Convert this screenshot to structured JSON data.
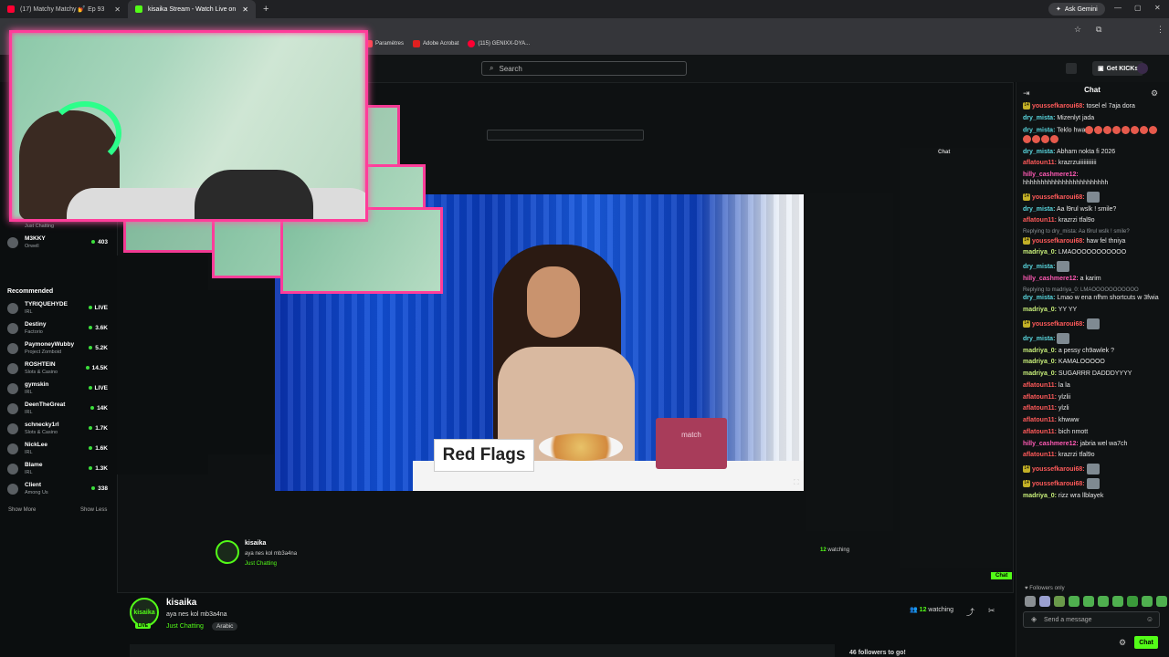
{
  "browser": {
    "tabs": [
      {
        "label": "(17) Matchy Matchy 💅 Ep 93 ",
        "color": "#ff0033"
      },
      {
        "label": "kisaika Stream - Watch Live on",
        "color": "#53fc18"
      }
    ],
    "ask_gemini": "Ask Gemini",
    "bookmarks": [
      "Paramètres",
      "Adobe Acrobat",
      "(115) GENIXX-DYA..."
    ]
  },
  "header": {
    "search_placeholder": "Search",
    "get_kicks": "Get KICKs"
  },
  "sidebar": {
    "top_items": [
      {
        "name": "M3KKY",
        "category": "Orwell",
        "count": "403"
      }
    ],
    "top_category": "Just Chatting",
    "recommended_title": "Recommended",
    "recommended": [
      {
        "name": "TYRIQUEHYDE",
        "category": "IRL",
        "count": "LIVE"
      },
      {
        "name": "Destiny",
        "category": "Factorio",
        "count": "3.6K"
      },
      {
        "name": "PaymoneyWubby",
        "category": "Project Zomboid",
        "count": "5.2K"
      },
      {
        "name": "ROSHTEIN",
        "category": "Slots & Casino",
        "count": "14.5K"
      },
      {
        "name": "gymskin",
        "category": "IRL",
        "count": "LIVE"
      },
      {
        "name": "DeenTheGreat",
        "category": "IRL",
        "count": "14K"
      },
      {
        "name": "schnecky1rl",
        "category": "Slots & Casino",
        "count": "1.7K"
      },
      {
        "name": "NickLee",
        "category": "IRL",
        "count": "1.6K"
      },
      {
        "name": "Blame",
        "category": "IRL",
        "count": "1.3K"
      },
      {
        "name": "Client",
        "category": "Among Us",
        "count": "338"
      }
    ],
    "show_more": "Show More",
    "show_less": "Show Less"
  },
  "video": {
    "red_flags": "Red Flags",
    "match_label": "match"
  },
  "stream": {
    "channel": "kisaika",
    "title": "aya nes kol mb3a4na",
    "category": "Just Chatting",
    "tag": "Arabic",
    "watching_count": "12",
    "watching_label": "watching",
    "live": "LIVE",
    "followers_goal": "46 followers to go!"
  },
  "chat": {
    "title": "Chat",
    "messages": [
      {
        "badge": "14",
        "user": "youssefkaroui68:",
        "color": "#ff5a5a",
        "text": " tosel el 7aja dora"
      },
      {
        "user": "dry_mista:",
        "color": "#5ad8e0",
        "text": " Mizenlyt jada"
      },
      {
        "user": "dry_mista:",
        "color": "#5ad8e0",
        "text": " Teklo hwa",
        "emotes": 12
      },
      {
        "user": "dry_mista:",
        "color": "#5ad8e0",
        "text": " Abham nokta fi 2026"
      },
      {
        "user": "aflatoun11:",
        "color": "#ff5a5a",
        "text": " krazrzuiiiiiiiiiiii"
      },
      {
        "user": "hilly_cashmere12:",
        "color": "#ff5ab4",
        "text": " hhhhhhhhhhhhhhhhhhhhhhhh"
      },
      {
        "badge": "14",
        "user": "youssefkaroui68:",
        "color": "#ff5a5a",
        "text": " ",
        "image": true
      },
      {
        "user": "dry_mista:",
        "color": "#5ad8e0",
        "text": " Aa l9rul wslk ! smile?"
      },
      {
        "user": "aflatoun11:",
        "color": "#ff5a5a",
        "text": " krazrzi tfal9o"
      },
      {
        "reply": "Replying to dry_mista: Aa l9rul wslk ! smile?",
        "badge": "14",
        "user": "youssefkaroui68:",
        "color": "#ff5a5a",
        "text": " haw fel thniya"
      },
      {
        "user": "madriya_0:",
        "color": "#c9f07a",
        "text": " LMAOOOOOOOOOOO"
      },
      {
        "user": "dry_mista:",
        "color": "#5ad8e0",
        "text": " ",
        "image": true
      },
      {
        "user": "hilly_cashmere12:",
        "color": "#ff5ab4",
        "text": " a karim"
      },
      {
        "reply": "Replying to madriya_0: LMAOOOOOOOOOOO",
        "user": "dry_mista:",
        "color": "#5ad8e0",
        "text": " Lmao w ena nfhm shortcuts w 3fwia"
      },
      {
        "user": "madriya_0:",
        "color": "#c9f07a",
        "text": " YY YY"
      },
      {
        "badge": "14",
        "user": "youssefkaroui68:",
        "color": "#ff5a5a",
        "text": " ",
        "image": true
      },
      {
        "user": "dry_mista:",
        "color": "#5ad8e0",
        "text": " ",
        "image": true
      },
      {
        "user": "madriya_0:",
        "color": "#c9f07a",
        "text": " a pessy ch9awlek ?"
      },
      {
        "user": "madriya_0:",
        "color": "#c9f07a",
        "text": " KAMALOOOOO"
      },
      {
        "user": "madriya_0:",
        "color": "#c9f07a",
        "text": " SUGARRR DADDDYYYY"
      },
      {
        "user": "aflatoun11:",
        "color": "#ff5a5a",
        "text": " la la"
      },
      {
        "user": "aflatoun11:",
        "color": "#ff5a5a",
        "text": " ylzlii"
      },
      {
        "user": "aflatoun11:",
        "color": "#ff5a5a",
        "text": " ylzli"
      },
      {
        "user": "aflatoun11:",
        "color": "#ff5a5a",
        "text": " khwww"
      },
      {
        "user": "aflatoun11:",
        "color": "#ff5a5a",
        "text": " bich nmott"
      },
      {
        "user": "hilly_cashmere12:",
        "color": "#ff5ab4",
        "text": " jabria wel wa7ch"
      },
      {
        "user": "aflatoun11:",
        "color": "#ff5a5a",
        "text": " krazrzi tfal9o"
      },
      {
        "badge": "14",
        "user": "youssefkaroui68:",
        "color": "#ff5a5a",
        "text": " ",
        "image": true
      },
      {
        "badge": "14",
        "user": "youssefkaroui68:",
        "color": "#ff5a5a",
        "text": " ",
        "image": true
      },
      {
        "user": "madriya_0:",
        "color": "#c9f07a",
        "text": " rizz wra llblayek"
      }
    ],
    "followers_only": "Followers only",
    "send_placeholder": "Send a message",
    "chat_button": "Chat"
  },
  "colors": {
    "accent": "#53fc18",
    "webcam_border": "#ff3d9a"
  }
}
